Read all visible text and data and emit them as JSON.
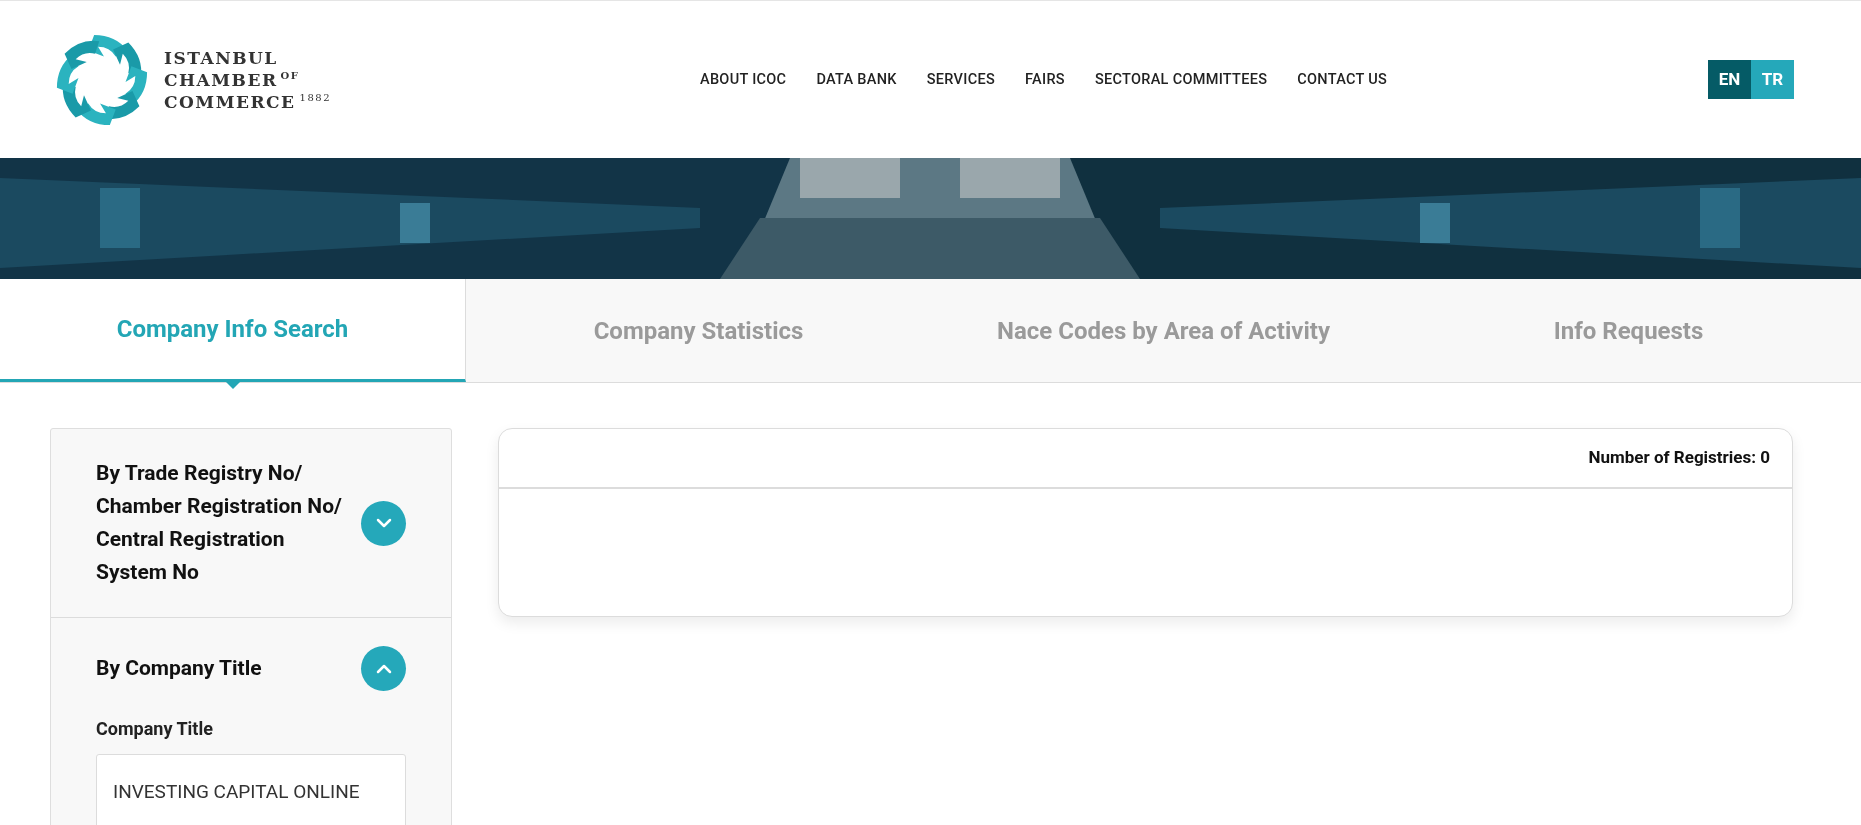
{
  "logo": {
    "line_1": "ISTANBUL",
    "line_2": "CHAMBER",
    "line_2_sup": "OF",
    "line_3": "COMMERCE",
    "year": "1882"
  },
  "nav": [
    "ABOUT ICOC",
    "DATA BANK",
    "SERVICES",
    "FAIRS",
    "SECTORAL COMMITTEES",
    "CONTACT US"
  ],
  "languages": [
    {
      "label": "EN",
      "selected": true
    },
    {
      "label": "TR",
      "selected": false
    }
  ],
  "tabs": [
    {
      "label": "Company Info Search",
      "selected": true
    },
    {
      "label": "Company Statistics",
      "selected": false
    },
    {
      "label": "Nace Codes by Area of Activity",
      "selected": false
    },
    {
      "label": "Info Requests",
      "selected": false
    }
  ],
  "filters": [
    {
      "title": "By Trade Registry No/ Chamber Registration No/ Central Registration System No",
      "expanded": false
    },
    {
      "title": "By Company Title",
      "expanded": true,
      "field_label": "Company Title",
      "value": "INVESTING CAPITAL ONLINE"
    }
  ],
  "results": {
    "count_label": "Number of Registries: 0"
  }
}
